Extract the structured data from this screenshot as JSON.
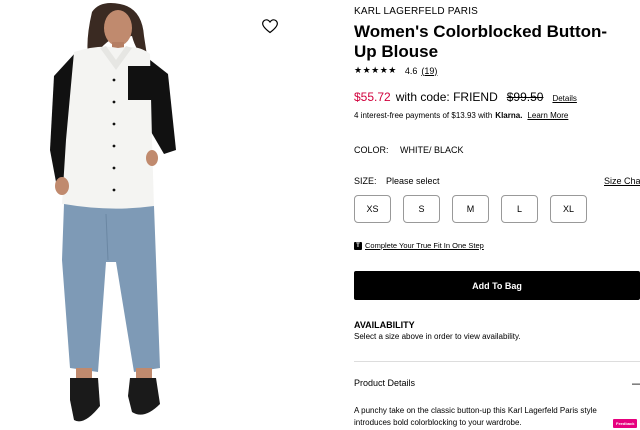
{
  "product": {
    "brand": "KARL LAGERFELD PARIS",
    "title": "Women's Colorblocked Button-Up Blouse",
    "rating": {
      "stars": "★★★★★",
      "value": "4.6",
      "count": "(19)",
      "stars_value": 4.6
    },
    "price": {
      "sale": "$55.72",
      "promo": "with code: FRIEND",
      "original": "$99.50",
      "details_link": "Details"
    },
    "installments": {
      "text": "4 interest-free payments of $13.93 with",
      "provider": "Klarna.",
      "learn_more": "Learn More"
    },
    "color": {
      "label": "COLOR:",
      "value": "WHITE/ BLACK"
    },
    "size": {
      "label": "SIZE:",
      "prompt": "Please select",
      "chart_link": "Size Chart",
      "options": [
        "XS",
        "S",
        "M",
        "L",
        "XL"
      ]
    },
    "truefit": {
      "icon_letter": "T",
      "link": "Complete Your True Fit In One Step"
    },
    "add_to_bag": "Add To Bag",
    "availability": {
      "title": "AVAILABILITY",
      "text": "Select a size above in order to view availability."
    },
    "product_details": {
      "label": "Product Details",
      "toggle": "—",
      "description": "A punchy take on the classic button-up this Karl Lagerfeld Paris style introduces bold colorblocking to your wardrobe."
    }
  },
  "icons": {
    "favorite": "heart-icon",
    "truefit": "truefit-icon"
  },
  "feedback_badge": "Feedback",
  "colors": {
    "sale": "#d1003c",
    "button": "#000000",
    "badge": "#e6007e"
  }
}
